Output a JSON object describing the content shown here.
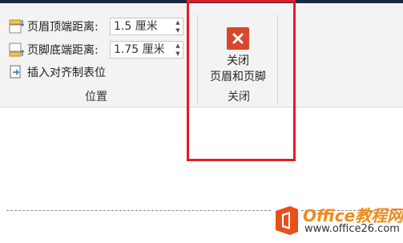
{
  "ribbon": {
    "header_from_top": {
      "label": "页眉顶端距离:",
      "value": "1.5 厘米"
    },
    "footer_from_bottom": {
      "label": "页脚底端距离:",
      "value": "1.75 厘米"
    },
    "insert_align_tab": {
      "label": "插入对齐制表位"
    },
    "position_group_label": "位置",
    "close_button": {
      "line1": "关闭",
      "line2": "页眉和页脚"
    },
    "close_group_label": "关闭"
  },
  "watermark": {
    "brand": "Office教程网",
    "url": "www.office26.com"
  },
  "colors": {
    "close_icon": "#d9472b",
    "highlight_border": "#e51b24",
    "watermark_orange": "#f08a16"
  }
}
